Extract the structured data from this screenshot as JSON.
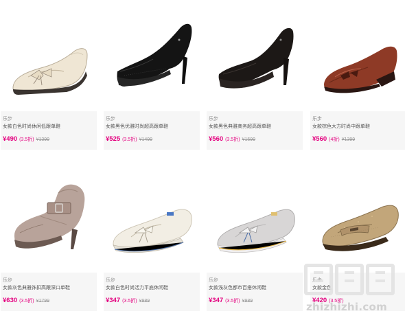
{
  "products": [
    {
      "brand": "乐步",
      "title": "女款白色时尚休闲低跟单鞋",
      "price": "¥490",
      "discount": "(3.5折)",
      "original": "¥1399",
      "icon": "cream-flat-loafer-with-bow"
    },
    {
      "brand": "乐步",
      "title": "女款黑色优雅时尚超高跟单鞋",
      "price": "¥525",
      "discount": "(3.5折)",
      "original": "¥1499",
      "icon": "black-patent-stiletto-pump"
    },
    {
      "brand": "乐步",
      "title": "女款黑色典雅商务超高跟单鞋",
      "price": "¥560",
      "discount": "(3.5折)",
      "original": "¥1599",
      "icon": "black-suede-platform-pump"
    },
    {
      "brand": "乐步",
      "title": "女款棕色大方时尚中跟单鞋",
      "price": "¥560",
      "discount": "(4折)",
      "original": "¥1399",
      "icon": "brown-wedge-pump-with-bow"
    },
    {
      "brand": "乐步",
      "title": "女款灰色典雅饰扣高跟深口单鞋",
      "price": "¥630",
      "discount": "(3.5折)",
      "original": "¥1799",
      "icon": "taupe-buckle-ankle-bootie"
    },
    {
      "brand": "乐步",
      "title": "女款白色时尚活力平底休闲鞋",
      "price": "¥347",
      "discount": "(3.5折)",
      "original": "¥989",
      "icon": "white-boat-shoe"
    },
    {
      "brand": "乐步",
      "title": "女款浅灰色都市百搭休闲鞋",
      "price": "¥347",
      "discount": "(3.5折)",
      "original": "¥989",
      "icon": "gray-boat-shoe"
    },
    {
      "brand": "乐步",
      "title": "女款金色",
      "price": "¥420",
      "discount": "(3.5折)",
      "original": "",
      "icon": "gold-penny-loafer"
    }
  ],
  "watermark": {
    "site": "zhizhizhi.com",
    "logo": "值值值"
  },
  "colors": {
    "price": "#e4007f",
    "info_bg": "#f6f6f6"
  }
}
